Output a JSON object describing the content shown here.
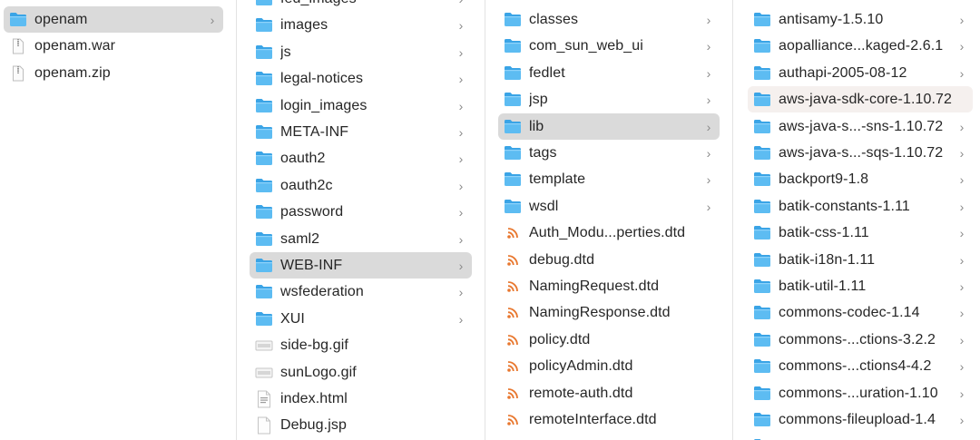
{
  "columns": [
    {
      "name": "column-1",
      "items": [
        {
          "label": "openam",
          "type": "folder",
          "chevron": true,
          "state": "selected"
        },
        {
          "label": "openam.war",
          "type": "archive",
          "chevron": false
        },
        {
          "label": "openam.zip",
          "type": "archive",
          "chevron": false
        }
      ]
    },
    {
      "name": "column-2",
      "items": [
        {
          "label": "fed_images",
          "type": "folder",
          "chevron": true
        },
        {
          "label": "images",
          "type": "folder",
          "chevron": true
        },
        {
          "label": "js",
          "type": "folder",
          "chevron": true
        },
        {
          "label": "legal-notices",
          "type": "folder",
          "chevron": true
        },
        {
          "label": "login_images",
          "type": "folder",
          "chevron": true
        },
        {
          "label": "META-INF",
          "type": "folder",
          "chevron": true
        },
        {
          "label": "oauth2",
          "type": "folder",
          "chevron": true
        },
        {
          "label": "oauth2c",
          "type": "folder",
          "chevron": true
        },
        {
          "label": "password",
          "type": "folder",
          "chevron": true
        },
        {
          "label": "saml2",
          "type": "folder",
          "chevron": true
        },
        {
          "label": "WEB-INF",
          "type": "folder",
          "chevron": true,
          "state": "selected"
        },
        {
          "label": "wsfederation",
          "type": "folder",
          "chevron": true
        },
        {
          "label": "XUI",
          "type": "folder",
          "chevron": true
        },
        {
          "label": "side-bg.gif",
          "type": "image-file",
          "chevron": false
        },
        {
          "label": "sunLogo.gif",
          "type": "image-file",
          "chevron": false
        },
        {
          "label": "index.html",
          "type": "html-file",
          "chevron": false
        },
        {
          "label": "Debug.jsp",
          "type": "text-file",
          "chevron": false
        }
      ]
    },
    {
      "name": "column-3",
      "items": [
        {
          "label": "classes",
          "type": "folder",
          "chevron": true
        },
        {
          "label": "com_sun_web_ui",
          "type": "folder",
          "chevron": true
        },
        {
          "label": "fedlet",
          "type": "folder",
          "chevron": true
        },
        {
          "label": "jsp",
          "type": "folder",
          "chevron": true
        },
        {
          "label": "lib",
          "type": "folder",
          "chevron": true,
          "state": "selected"
        },
        {
          "label": "tags",
          "type": "folder",
          "chevron": true
        },
        {
          "label": "template",
          "type": "folder",
          "chevron": true
        },
        {
          "label": "wsdl",
          "type": "folder",
          "chevron": true
        },
        {
          "label": "Auth_Modu...perties.dtd",
          "type": "dtd-file",
          "chevron": false
        },
        {
          "label": "debug.dtd",
          "type": "dtd-file",
          "chevron": false
        },
        {
          "label": "NamingRequest.dtd",
          "type": "dtd-file",
          "chevron": false
        },
        {
          "label": "NamingResponse.dtd",
          "type": "dtd-file",
          "chevron": false
        },
        {
          "label": "policy.dtd",
          "type": "dtd-file",
          "chevron": false
        },
        {
          "label": "policyAdmin.dtd",
          "type": "dtd-file",
          "chevron": false
        },
        {
          "label": "remote-auth.dtd",
          "type": "dtd-file",
          "chevron": false
        },
        {
          "label": "remoteInterface.dtd",
          "type": "dtd-file",
          "chevron": false
        }
      ]
    },
    {
      "name": "column-4",
      "items": [
        {
          "label": "antisamy-1.5.10",
          "type": "folder",
          "chevron": true
        },
        {
          "label": "aopalliance...kaged-2.6.1",
          "type": "folder",
          "chevron": true
        },
        {
          "label": "authapi-2005-08-12",
          "type": "folder",
          "chevron": true
        },
        {
          "label": "aws-java-sdk-core-1.10.72",
          "type": "folder",
          "chevron": false,
          "state": "hover"
        },
        {
          "label": "aws-java-s...-sns-1.10.72",
          "type": "folder",
          "chevron": true
        },
        {
          "label": "aws-java-s...-sqs-1.10.72",
          "type": "folder",
          "chevron": true
        },
        {
          "label": "backport9-1.8",
          "type": "folder",
          "chevron": true
        },
        {
          "label": "batik-constants-1.11",
          "type": "folder",
          "chevron": true
        },
        {
          "label": "batik-css-1.11",
          "type": "folder",
          "chevron": true
        },
        {
          "label": "batik-i18n-1.11",
          "type": "folder",
          "chevron": true
        },
        {
          "label": "batik-util-1.11",
          "type": "folder",
          "chevron": true
        },
        {
          "label": "commons-codec-1.14",
          "type": "folder",
          "chevron": true
        },
        {
          "label": "commons-...ctions-3.2.2",
          "type": "folder",
          "chevron": true
        },
        {
          "label": "commons-...ctions4-4.2",
          "type": "folder",
          "chevron": true
        },
        {
          "label": "commons-...uration-1.10",
          "type": "folder",
          "chevron": true
        },
        {
          "label": "commons-fileupload-1.4",
          "type": "folder",
          "chevron": true
        },
        {
          "label": "",
          "type": "folder",
          "chevron": false
        }
      ]
    }
  ],
  "icons": {
    "folder": "folder-icon",
    "archive": "archive-file-icon",
    "image-file": "image-file-icon",
    "html-file": "html-file-icon",
    "text-file": "text-file-icon",
    "dtd-file": "rss-file-icon"
  },
  "colors": {
    "folder_front": "#5dbcf2",
    "folder_back": "#3aa4e6",
    "selected_row": "#dadada",
    "hover_row": "#f5f0ee",
    "dtd_icon": "#e8772e"
  },
  "chevron_glyph": "›"
}
